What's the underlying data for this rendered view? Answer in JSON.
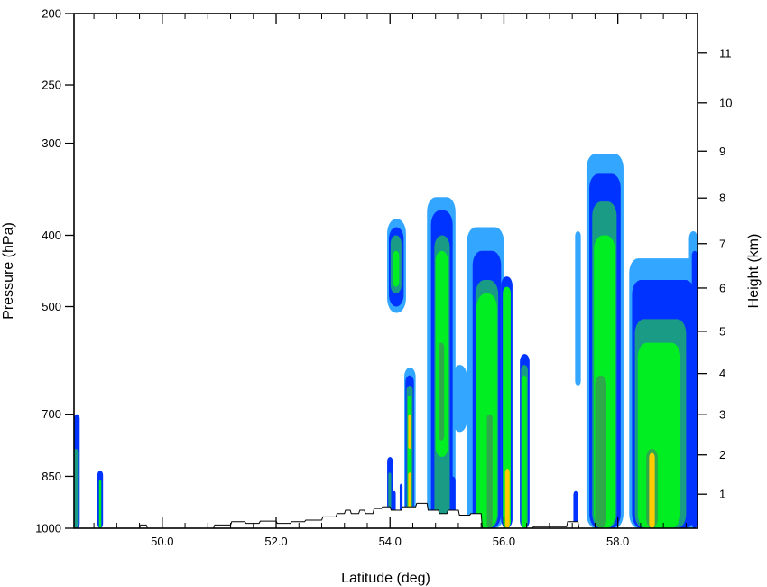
{
  "chart_data": {
    "type": "heatmap",
    "title": "",
    "xlabel": "Latitude (deg)",
    "ylabel": "Pressure (hPa)",
    "ylabel_right": "Height (km)",
    "xlim": [
      48.45,
      59.4
    ],
    "ylim_pressure": [
      1000,
      200
    ],
    "y_scale": "log",
    "grid": false,
    "x_ticks": [
      {
        "value": 50.0,
        "label": "50.0"
      },
      {
        "value": 52.0,
        "label": "52.0"
      },
      {
        "value": 54.0,
        "label": "54.0"
      },
      {
        "value": 56.0,
        "label": "56.0"
      },
      {
        "value": 58.0,
        "label": "58.0"
      }
    ],
    "y_ticks": [
      {
        "value": 200,
        "label": "200"
      },
      {
        "value": 250,
        "label": "250"
      },
      {
        "value": 300,
        "label": "300"
      },
      {
        "value": 400,
        "label": "400"
      },
      {
        "value": 500,
        "label": "500"
      },
      {
        "value": 700,
        "label": "700"
      },
      {
        "value": 850,
        "label": "850"
      },
      {
        "value": 1000,
        "label": "1000"
      }
    ],
    "height_ticks": [
      {
        "value": 1,
        "label": "1"
      },
      {
        "value": 2,
        "label": "2"
      },
      {
        "value": 3,
        "label": "3"
      },
      {
        "value": 4,
        "label": "4"
      },
      {
        "value": 5,
        "label": "5"
      },
      {
        "value": 6,
        "label": "6"
      },
      {
        "value": 7,
        "label": "7"
      },
      {
        "value": 8,
        "label": "8"
      },
      {
        "value": 9,
        "label": "9"
      },
      {
        "value": 10,
        "label": "10"
      },
      {
        "value": 11,
        "label": "11"
      }
    ],
    "contour_colors": [
      "#33a6ff",
      "#0033ff",
      "#1a9b86",
      "#00ee22",
      "#2ea84a",
      "#ffcc00",
      "#ff9900"
    ],
    "cells": [
      {
        "lat0": 48.45,
        "lat1": 48.55,
        "p_top": 700,
        "level": 1,
        "fill": "#0033ff"
      },
      {
        "lat0": 48.45,
        "lat1": 48.52,
        "p_top": 780,
        "level": 2,
        "fill": "#1a9b86"
      },
      {
        "lat0": 48.86,
        "lat1": 48.96,
        "p_top": 835,
        "level": 1,
        "fill": "#0033ff"
      },
      {
        "lat0": 48.89,
        "lat1": 48.93,
        "p_top": 860,
        "level": 2,
        "fill": "#00ee22"
      },
      {
        "lat0": 53.95,
        "lat1": 54.05,
        "p_top": 800,
        "level": 1,
        "fill": "#0033ff"
      },
      {
        "lat0": 53.97,
        "lat1": 54.02,
        "p_top": 840,
        "level": 2,
        "fill": "#1a9b86"
      },
      {
        "lat0": 54.05,
        "lat1": 54.1,
        "p_top": 890,
        "level": 1,
        "fill": "#0033ff"
      },
      {
        "lat0": 54.17,
        "lat1": 54.22,
        "p_top": 870,
        "level": 1,
        "fill": "#0033ff"
      },
      {
        "lat0": 53.95,
        "lat1": 54.28,
        "p_top": 380,
        "p_bot": 510,
        "level": 0,
        "fill": "#33a6ff"
      },
      {
        "lat0": 53.98,
        "lat1": 54.24,
        "p_top": 390,
        "p_bot": 500,
        "level": 1,
        "fill": "#0033ff"
      },
      {
        "lat0": 54.01,
        "lat1": 54.2,
        "p_top": 400,
        "p_bot": 480,
        "level": 2,
        "fill": "#1a9b86"
      },
      {
        "lat0": 54.05,
        "lat1": 54.16,
        "p_top": 420,
        "p_bot": 470,
        "level": 3,
        "fill": "#00ee22"
      },
      {
        "lat0": 54.25,
        "lat1": 54.45,
        "p_top": 605,
        "level": 0,
        "fill": "#33a6ff"
      },
      {
        "lat0": 54.27,
        "lat1": 54.42,
        "p_top": 620,
        "level": 1,
        "fill": "#0033ff"
      },
      {
        "lat0": 54.29,
        "lat1": 54.4,
        "p_top": 640,
        "level": 2,
        "fill": "#1a9b86"
      },
      {
        "lat0": 54.31,
        "lat1": 54.38,
        "p_top": 660,
        "level": 3,
        "fill": "#00ee22"
      },
      {
        "lat0": 54.32,
        "lat1": 54.37,
        "p_top": 700,
        "p_bot": 780,
        "level": 5,
        "fill": "#ffcc00"
      },
      {
        "lat0": 54.32,
        "lat1": 54.37,
        "p_top": 840,
        "level": 5,
        "fill": "#ffcc00"
      },
      {
        "lat0": 54.65,
        "lat1": 55.15,
        "p_top": 355,
        "level": 0,
        "fill": "#33a6ff"
      },
      {
        "lat0": 54.72,
        "lat1": 55.1,
        "p_top": 370,
        "level": 1,
        "fill": "#0033ff"
      },
      {
        "lat0": 54.78,
        "lat1": 55.05,
        "p_top": 400,
        "level": 2,
        "fill": "#1a9b86"
      },
      {
        "lat0": 54.8,
        "lat1": 55.02,
        "p_top": 420,
        "p_bot": 800,
        "level": 3,
        "fill": "#00ee22"
      },
      {
        "lat0": 54.85,
        "lat1": 54.95,
        "p_top": 560,
        "p_bot": 760,
        "level": 4,
        "fill": "#2ea84a"
      },
      {
        "lat0": 55.1,
        "lat1": 55.35,
        "p_top": 600,
        "p_bot": 740,
        "level": 0,
        "fill": "#33a6ff"
      },
      {
        "lat0": 55.05,
        "lat1": 55.15,
        "p_top": 850,
        "level": 1,
        "fill": "#0033ff"
      },
      {
        "lat0": 55.35,
        "lat1": 56.0,
        "p_top": 390,
        "level": 0,
        "fill": "#33a6ff"
      },
      {
        "lat0": 55.45,
        "lat1": 55.95,
        "p_top": 420,
        "level": 1,
        "fill": "#0033ff"
      },
      {
        "lat0": 55.5,
        "lat1": 55.9,
        "p_top": 460,
        "level": 2,
        "fill": "#1a9b86"
      },
      {
        "lat0": 55.52,
        "lat1": 55.88,
        "p_top": 480,
        "level": 3,
        "fill": "#00ee22"
      },
      {
        "lat0": 55.7,
        "lat1": 55.8,
        "p_top": 700,
        "level": 4,
        "fill": "#2ea84a"
      },
      {
        "lat0": 55.95,
        "lat1": 56.15,
        "p_top": 455,
        "level": 1,
        "fill": "#0033ff"
      },
      {
        "lat0": 55.98,
        "lat1": 56.12,
        "p_top": 470,
        "level": 3,
        "fill": "#00ee22"
      },
      {
        "lat0": 56.02,
        "lat1": 56.1,
        "p_top": 830,
        "level": 5,
        "fill": "#ffcc00"
      },
      {
        "lat0": 56.28,
        "lat1": 56.45,
        "p_top": 580,
        "level": 1,
        "fill": "#0033ff"
      },
      {
        "lat0": 56.3,
        "lat1": 56.42,
        "p_top": 600,
        "level": 2,
        "fill": "#1a9b86"
      },
      {
        "lat0": 56.32,
        "lat1": 56.4,
        "p_top": 620,
        "level": 3,
        "fill": "#00ee22"
      },
      {
        "lat0": 57.22,
        "lat1": 57.3,
        "p_top": 890,
        "level": 1,
        "fill": "#0033ff"
      },
      {
        "lat0": 57.25,
        "lat1": 57.35,
        "p_top": 395,
        "p_bot": 640,
        "level": 0,
        "fill": "#33a6ff"
      },
      {
        "lat0": 57.45,
        "lat1": 58.1,
        "p_top": 310,
        "level": 0,
        "fill": "#33a6ff"
      },
      {
        "lat0": 57.5,
        "lat1": 58.05,
        "p_top": 330,
        "level": 1,
        "fill": "#0033ff"
      },
      {
        "lat0": 57.55,
        "lat1": 57.98,
        "p_top": 360,
        "level": 2,
        "fill": "#1a9b86"
      },
      {
        "lat0": 57.58,
        "lat1": 57.95,
        "p_top": 400,
        "level": 3,
        "fill": "#00ee22"
      },
      {
        "lat0": 57.6,
        "lat1": 57.8,
        "p_top": 620,
        "level": 4,
        "fill": "#2ea84a"
      },
      {
        "lat0": 58.2,
        "lat1": 59.4,
        "p_top": 430,
        "level": 0,
        "fill": "#33a6ff"
      },
      {
        "lat0": 58.25,
        "lat1": 59.35,
        "p_top": 460,
        "level": 1,
        "fill": "#0033ff"
      },
      {
        "lat0": 58.3,
        "lat1": 59.2,
        "p_top": 520,
        "level": 2,
        "fill": "#1a9b86"
      },
      {
        "lat0": 58.35,
        "lat1": 59.1,
        "p_top": 560,
        "level": 3,
        "fill": "#00ee22"
      },
      {
        "lat0": 58.5,
        "lat1": 58.7,
        "p_top": 780,
        "level": 4,
        "fill": "#2ea84a"
      },
      {
        "lat0": 58.55,
        "lat1": 58.65,
        "p_top": 790,
        "level": 5,
        "fill": "#ffcc00"
      },
      {
        "lat0": 59.25,
        "lat1": 59.4,
        "p_top": 395,
        "level": 0,
        "fill": "#33a6ff"
      },
      {
        "lat0": 59.3,
        "lat1": 59.4,
        "p_top": 420,
        "level": 1,
        "fill": "#0033ff"
      }
    ],
    "terrain": {
      "lat": [
        48.45,
        49.6,
        49.62,
        49.72,
        49.74,
        50.9,
        50.92,
        51.2,
        51.22,
        51.45,
        51.47,
        51.7,
        51.72,
        52.0,
        52.02,
        52.25,
        52.27,
        52.5,
        52.52,
        52.8,
        52.82,
        53.05,
        53.07,
        53.2,
        53.22,
        53.3,
        53.32,
        53.45,
        53.47,
        53.55,
        53.57,
        53.7,
        53.72,
        53.85,
        53.87,
        54.0,
        54.02,
        54.2,
        54.22,
        54.45,
        54.47,
        54.65,
        54.67,
        54.85,
        54.87,
        55.0,
        55.02,
        55.2,
        55.22,
        55.4,
        55.42,
        55.6,
        55.62,
        56.5,
        56.52,
        57.1,
        57.12,
        57.3,
        57.32,
        59.4
      ],
      "p": [
        1000,
        1000,
        990,
        990,
        1000,
        1000,
        990,
        990,
        980,
        980,
        985,
        985,
        978,
        978,
        985,
        985,
        980,
        980,
        975,
        975,
        965,
        965,
        955,
        955,
        945,
        945,
        955,
        955,
        945,
        945,
        955,
        955,
        940,
        940,
        935,
        935,
        945,
        945,
        935,
        935,
        925,
        925,
        945,
        945,
        955,
        955,
        945,
        945,
        960,
        960,
        955,
        955,
        1000,
        1000,
        995,
        995,
        980,
        980,
        1000,
        1000
      ]
    }
  }
}
